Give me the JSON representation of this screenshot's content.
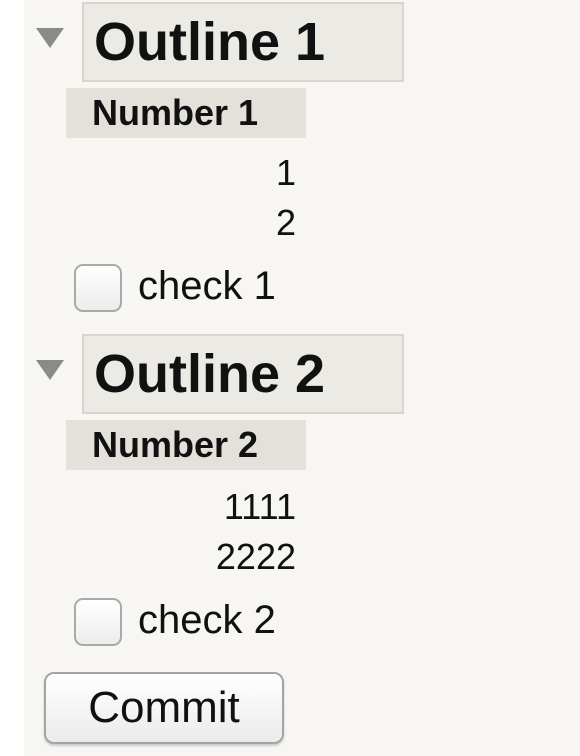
{
  "outlines": [
    {
      "title": "Outline 1",
      "column_header": "Number 1",
      "values": [
        "1",
        "2"
      ],
      "checkbox_label": "check 1",
      "checked": false
    },
    {
      "title": "Outline 2",
      "column_header": "Number 2",
      "values": [
        "1111",
        "2222"
      ],
      "checkbox_label": "check 2",
      "checked": false
    }
  ],
  "commit_label": "Commit",
  "icons": {
    "toggle": "disclosure-triangle-down-icon"
  }
}
